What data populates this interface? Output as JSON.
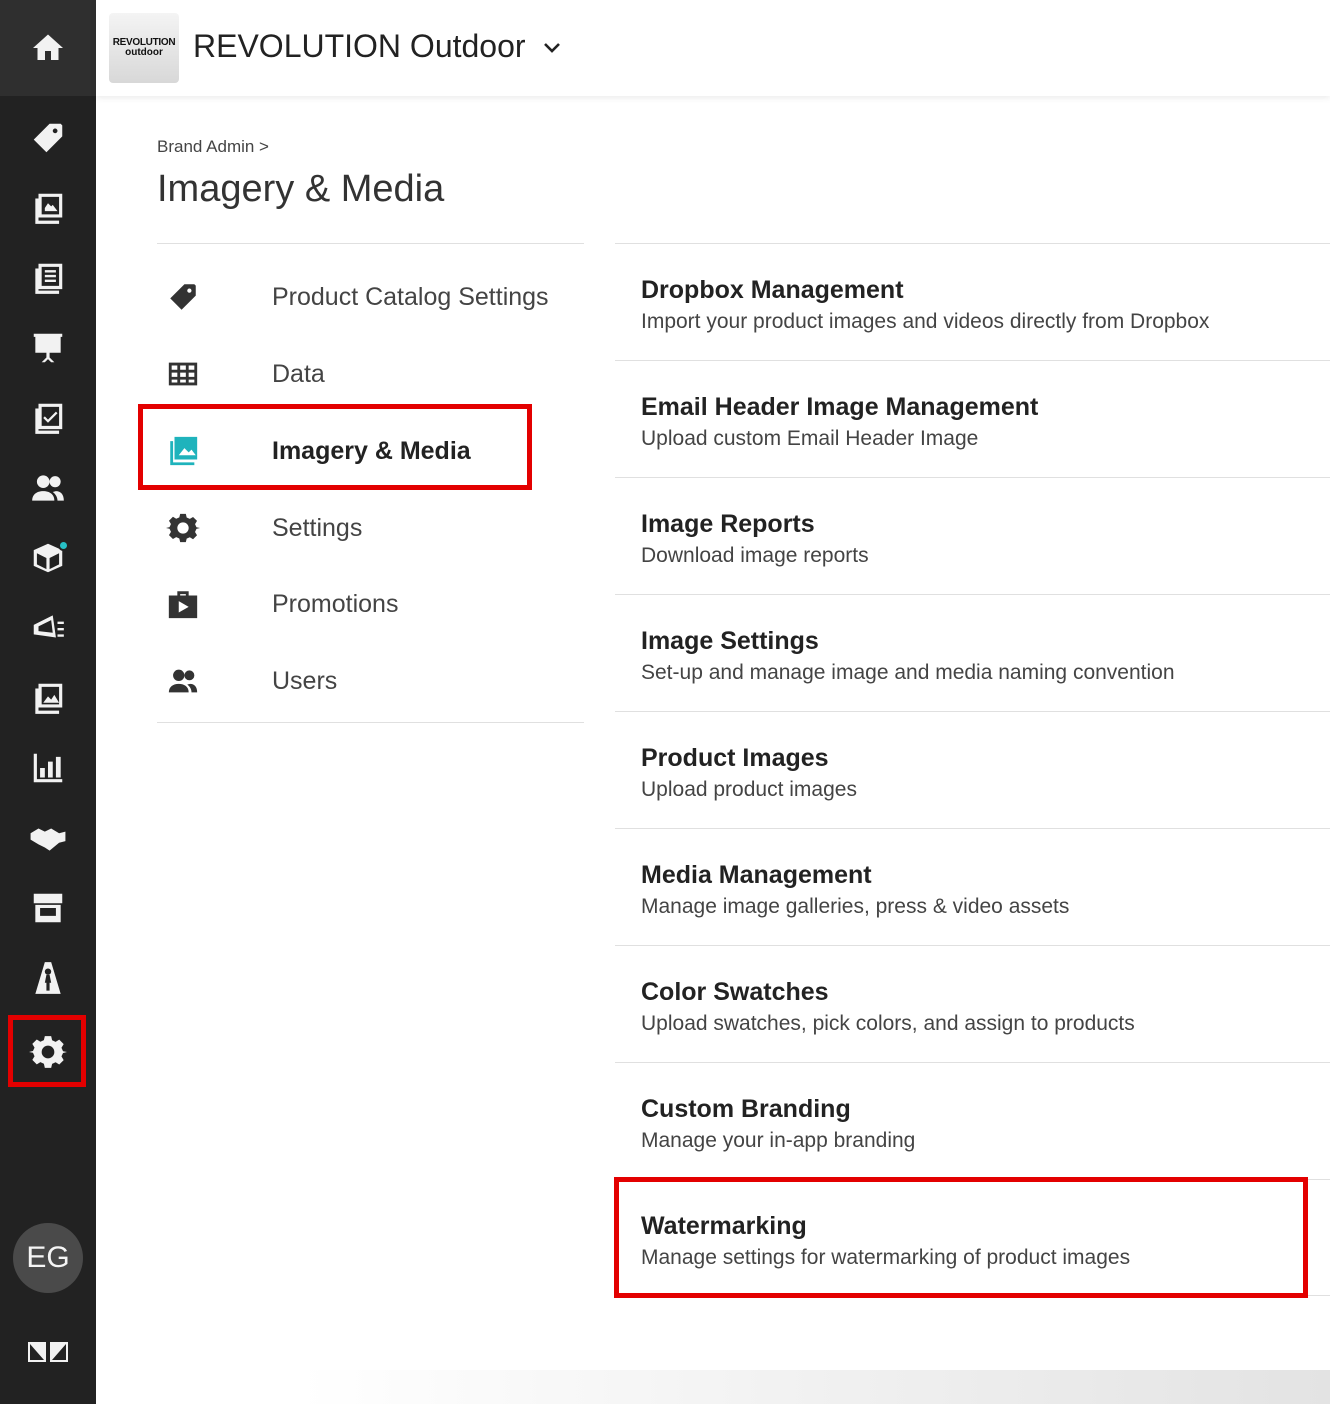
{
  "brand": {
    "logo_line1": "REVOLUTION",
    "logo_line2": "outdoor",
    "name": "REVOLUTION Outdoor"
  },
  "user": {
    "initials": "EG"
  },
  "rail": {
    "items": [
      {
        "name": "price-tag-icon"
      },
      {
        "name": "catalog-icon"
      },
      {
        "name": "line-sheet-icon"
      },
      {
        "name": "presentation-icon"
      },
      {
        "name": "orders-check-icon"
      },
      {
        "name": "customers-icon"
      },
      {
        "name": "shipping-box-icon"
      },
      {
        "name": "marketing-icon"
      },
      {
        "name": "images-icon"
      },
      {
        "name": "analytics-icon"
      },
      {
        "name": "handshake-icon"
      },
      {
        "name": "storefront-icon"
      },
      {
        "name": "model-icon"
      },
      {
        "name": "settings-gear-icon"
      }
    ]
  },
  "breadcrumb": "Brand Admin >",
  "page_title": "Imagery & Media",
  "menu": {
    "items": [
      {
        "label": "Product Catalog Settings",
        "icon": "tag-icon"
      },
      {
        "label": "Data",
        "icon": "table-icon"
      },
      {
        "label": "Imagery & Media",
        "icon": "image-icon",
        "active": true
      },
      {
        "label": "Settings",
        "icon": "gear-icon"
      },
      {
        "label": "Promotions",
        "icon": "promo-bag-icon"
      },
      {
        "label": "Users",
        "icon": "users-icon"
      }
    ]
  },
  "options": [
    {
      "title": "Dropbox Management",
      "description": "Import your product images and videos directly from Dropbox"
    },
    {
      "title": "Email Header Image Management",
      "description": "Upload custom Email Header Image"
    },
    {
      "title": "Image Reports",
      "description": "Download image reports"
    },
    {
      "title": "Image Settings",
      "description": "Set-up and manage image and media naming convention"
    },
    {
      "title": "Product Images",
      "description": "Upload product images"
    },
    {
      "title": "Media Management",
      "description": "Manage image galleries, press & video assets"
    },
    {
      "title": "Color Swatches",
      "description": "Upload swatches, pick colors, and assign to products"
    },
    {
      "title": "Custom Branding",
      "description": "Manage your in-app branding"
    },
    {
      "title": "Watermarking",
      "description": "Manage settings for watermarking of product images"
    }
  ],
  "colors": {
    "rail_bg": "#222222",
    "accent": "#1fb3bc",
    "highlight": "#e30000"
  }
}
